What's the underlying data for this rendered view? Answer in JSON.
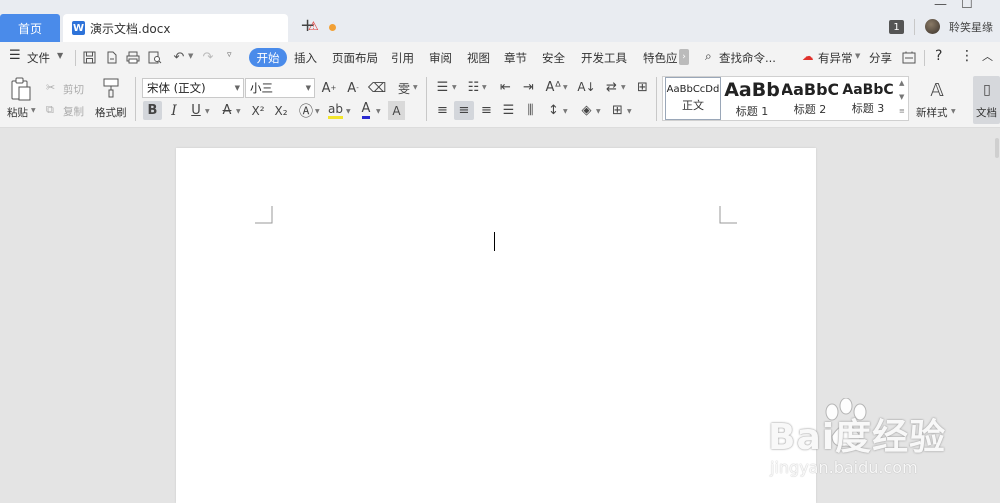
{
  "tabs": {
    "home": "首页",
    "doc": "演示文档.docx",
    "new": "+"
  },
  "window": {
    "minimize": "—",
    "maximize": "☐"
  },
  "user": {
    "badge": "1",
    "name": "聆笑星缘"
  },
  "menu": {
    "file": "文件",
    "items": [
      "开始",
      "插入",
      "页面布局",
      "引用",
      "审阅",
      "视图",
      "章节",
      "安全",
      "开发工具",
      "特色应"
    ],
    "search": "查找命令...",
    "anomaly": "有异常",
    "share": "分享",
    "help": "?"
  },
  "ribbon": {
    "paste": "粘贴",
    "cut": "剪切",
    "copy": "复制",
    "format_painter": "格式刷",
    "font_name": "宋体 (正文)",
    "font_size": "小三",
    "bold": "B",
    "italic": "I",
    "underline": "U",
    "strike": "A",
    "superscript": "X²",
    "subscript": "X₂",
    "new_style": "新样式",
    "doc_helper": "文档"
  },
  "styles": [
    {
      "preview": "AaBbCcDd",
      "label": "正文"
    },
    {
      "preview": "AaBb",
      "label": "标题 1"
    },
    {
      "preview": "AaBbC",
      "label": "标题 2"
    },
    {
      "preview": "AaBbC",
      "label": "标题 3"
    }
  ],
  "watermark": {
    "main": "Bai度经验",
    "sub": "jingyan.baidu.com"
  },
  "colors": {
    "accent": "#4a8bea",
    "warning": "#e0312c",
    "unsaved_dot": "#f2a035"
  }
}
